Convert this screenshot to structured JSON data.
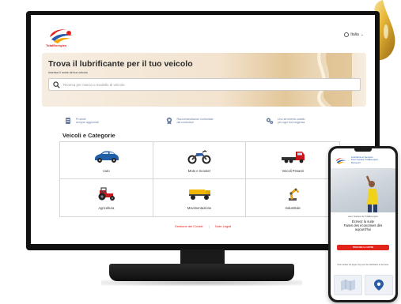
{
  "header": {
    "brand_text": "TotalEnergies",
    "language_label": "Italia"
  },
  "hero": {
    "title": "Trova il lubrificante per il tuo veicolo",
    "subtitle": "Inserisci il nome del tuo veicolo",
    "search_placeholder": "Ricerca per marca o modello di veicolo"
  },
  "features": [
    {
      "icon": "document-icon",
      "text_line1": "Prodotti",
      "text_line2": "sempre aggiornati"
    },
    {
      "icon": "badge-icon",
      "text_line1": "Raccomandazioni controllate",
      "text_line2": "dai costruttori"
    },
    {
      "icon": "gears-icon",
      "text_line1": "Uno strumento adatto",
      "text_line2": "per ogni tua esigenza"
    }
  ],
  "section_title": "Veicoli e Categorie",
  "categories": [
    {
      "label": "Auto",
      "icon": "car-icon"
    },
    {
      "label": "Moto e Scooter",
      "icon": "motorcycle-icon"
    },
    {
      "label": "Veicoli Pesanti",
      "icon": "truck-icon"
    },
    {
      "label": "Agricoltura",
      "icon": "tractor-icon"
    },
    {
      "label": "Movimentazione",
      "icon": "dumper-icon"
    },
    {
      "label": "Industriale",
      "icon": "robot-arm-icon"
    }
  ],
  "footer": {
    "link1": "Gestione dei Cookie",
    "separator": "|",
    "link2": "Note Legali"
  },
  "phone": {
    "header_line1": "Lubrifiants et Services",
    "header_line2": "Pour l'équipe TotalEnergies",
    "header_line3": "Découvrir",
    "caption": "avec l'équipe de TotalEnergies",
    "headline_line1": "Écrivez la suite",
    "headline_line2": "Faites des économies dès",
    "headline_line3": "aujourd'hui",
    "button_label": "TROUVER LE VOTRE",
    "more_text": "Pour arrêter de payer trop pour les lubrifiants et services"
  },
  "colors": {
    "brand_red": "#e2231a",
    "brand_blue": "#2a5aa8",
    "feature_text": "#6a7fa0"
  }
}
